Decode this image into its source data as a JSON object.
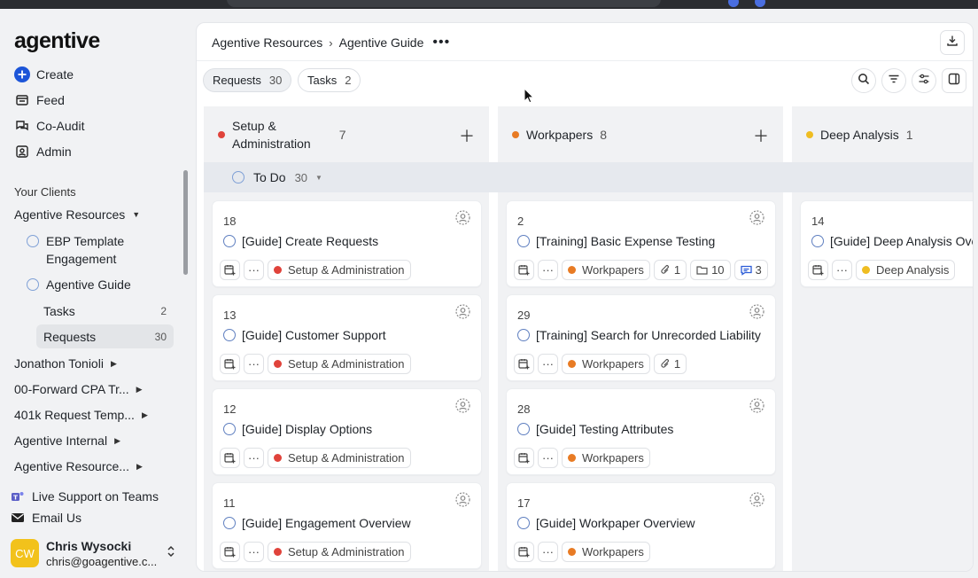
{
  "app": {
    "logo": "agentive"
  },
  "nav": [
    {
      "label": "Create",
      "icon": "plus-circle-icon"
    },
    {
      "label": "Feed",
      "icon": "feed-icon"
    },
    {
      "label": "Co-Audit",
      "icon": "co-audit-icon"
    },
    {
      "label": "Admin",
      "icon": "admin-icon"
    }
  ],
  "clients": {
    "title": "Your Clients",
    "top": {
      "label": "Agentive Resources"
    },
    "engagements": [
      {
        "label_line1": "EBP Template",
        "label_line2": "Engagement"
      },
      {
        "label_line1": "Agentive Guide"
      }
    ],
    "leaves": [
      {
        "label": "Tasks",
        "count": "2"
      },
      {
        "label": "Requests",
        "count": "30"
      }
    ],
    "others": [
      {
        "label": "Jonathon Tonioli"
      },
      {
        "label": "00-Forward CPA Tr..."
      },
      {
        "label": "401k Request Temp..."
      },
      {
        "label": "Agentive Internal"
      },
      {
        "label": "Agentive Resource..."
      }
    ]
  },
  "footer": {
    "support": "Live Support on Teams",
    "email": "Email Us",
    "user": {
      "initials": "CW",
      "name": "Chris Wysocki",
      "email": "chris@goagentive.c..."
    }
  },
  "header": {
    "breadcrumb": [
      "Agentive Resources",
      "Agentive Guide"
    ],
    "more": "•••"
  },
  "tabs": [
    {
      "label": "Requests",
      "count": "30"
    },
    {
      "label": "Tasks",
      "count": "2"
    }
  ],
  "group": {
    "label": "To Do",
    "count": "30"
  },
  "columns": [
    {
      "title_line1": "Setup &",
      "title_line2": "Administration",
      "count": "7",
      "color": "#e0433b",
      "cards": [
        {
          "num": "18",
          "title": "[Guide] Create Requests",
          "tag": "Setup & Administration"
        },
        {
          "num": "13",
          "title": "[Guide] Customer Support",
          "tag": "Setup & Administration"
        },
        {
          "num": "12",
          "title": "[Guide] Display Options",
          "tag": "Setup & Administration"
        },
        {
          "num": "11",
          "title": "[Guide] Engagement Overview",
          "tag": "Setup & Administration"
        }
      ]
    },
    {
      "title_line1": "Workpapers",
      "count": "8",
      "color": "#e87b24",
      "cards": [
        {
          "num": "2",
          "title": "[Training] Basic Expense Testing",
          "tag": "Workpapers",
          "attach": "1",
          "folder": "10",
          "comments": "3"
        },
        {
          "num": "29",
          "title": "[Training] Search for Unrecorded Liability",
          "tag": "Workpapers",
          "attach": "1"
        },
        {
          "num": "28",
          "title": "[Guide] Testing Attributes",
          "tag": "Workpapers"
        },
        {
          "num": "17",
          "title": "[Guide] Workpaper Overview",
          "tag": "Workpapers"
        }
      ]
    },
    {
      "title_line1": "Deep Analysis",
      "count": "1",
      "color": "#efbd22",
      "cards": [
        {
          "num": "14",
          "title": "[Guide] Deep Analysis Overview",
          "tag": "Deep Analysis"
        }
      ]
    }
  ]
}
